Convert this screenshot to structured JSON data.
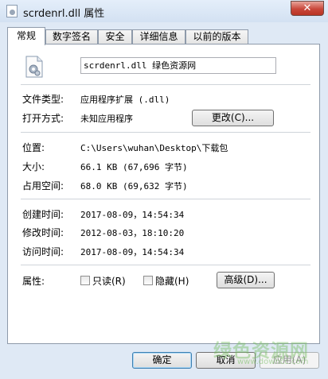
{
  "window": {
    "title": "scrdenrl.dll 属性",
    "close_glyph": "✕"
  },
  "tabs": [
    {
      "label": "常规",
      "active": true
    },
    {
      "label": "数字签名"
    },
    {
      "label": "安全"
    },
    {
      "label": "详细信息"
    },
    {
      "label": "以前的版本"
    }
  ],
  "general": {
    "file_name": "scrdenrl.dll",
    "name_suffix": "绿色资源网",
    "file_type_label": "文件类型:",
    "file_type_value": "应用程序扩展 (.dll)",
    "opens_with_label": "打开方式:",
    "opens_with_value": "未知应用程序",
    "change_button": "更改(C)...",
    "location_label": "位置:",
    "location_value": "C:\\Users\\wuhan\\Desktop\\下载包",
    "size_label": "大小:",
    "size_value": "66.1 KB (67,696 字节)",
    "size_on_disk_label": "占用空间:",
    "size_on_disk_value": "68.0 KB (69,632 字节)",
    "created_label": "创建时间:",
    "created_value": "2017-08-09，14:54:34",
    "modified_label": "修改时间:",
    "modified_value": "2012-08-03，18:10:20",
    "accessed_label": "访问时间:",
    "accessed_value": "2017-08-09，14:54:34",
    "attributes_label": "属性:",
    "readonly_label": "只读(R)",
    "readonly_checked": false,
    "hidden_label": "隐藏(H)",
    "hidden_checked": false,
    "advanced_button": "高级(D)..."
  },
  "footer": {
    "ok": "确定",
    "cancel": "取消",
    "apply": "应用(A)"
  },
  "watermark": {
    "text": "绿色资源网",
    "url": "www.downcc.com"
  },
  "colors": {
    "window_bg": "#dfe9f5",
    "close_button": "#c9473a",
    "default_button_border": "#3c7fb1"
  }
}
